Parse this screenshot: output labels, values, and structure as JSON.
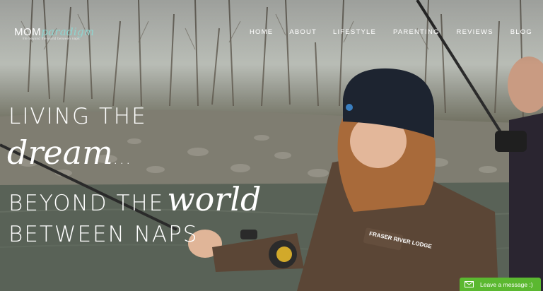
{
  "logo": {
    "brand": "MOM",
    "script": "paradigm",
    "tagline": "life beyond the world between naps"
  },
  "nav": {
    "items": [
      "HOME",
      "ABOUT",
      "LIFESTYLE",
      "PARENTING",
      "REVIEWS",
      "BLOG"
    ]
  },
  "hero": {
    "line1": "LIVING THE",
    "script1": "dream",
    "ellipsis": "...",
    "line2": "BEYOND THE",
    "script2": "world",
    "line3": "BETWEEN NAPS",
    "jacket_patch": "FRASER RIVER LODGE"
  },
  "chat": {
    "label": "Leave a message :)"
  }
}
